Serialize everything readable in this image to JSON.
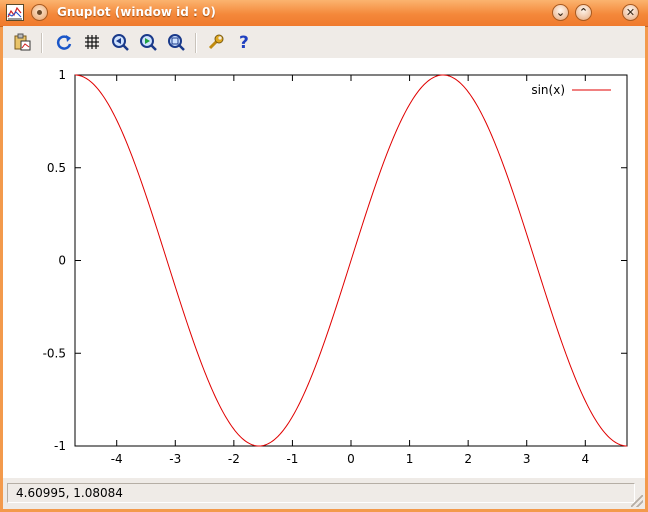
{
  "window": {
    "title": "Gnuplot (window id : 0)"
  },
  "toolbar": {
    "items": [
      {
        "name": "copy-clipboard-icon"
      },
      {
        "name": "replot-icon"
      },
      {
        "name": "grid-icon"
      },
      {
        "name": "zoom-prev-icon"
      },
      {
        "name": "zoom-next-icon"
      },
      {
        "name": "zoom-autoscale-icon"
      },
      {
        "name": "settings-wrench-icon"
      },
      {
        "name": "help-icon"
      }
    ]
  },
  "status": {
    "coordinates": "4.60995,  1.08084"
  },
  "chart_data": {
    "type": "line",
    "title": "",
    "xlabel": "",
    "ylabel": "",
    "xlim": [
      -4.712,
      4.712
    ],
    "ylim": [
      -1,
      1
    ],
    "x_ticks": [
      -4,
      -3,
      -2,
      -1,
      0,
      1,
      2,
      3,
      4
    ],
    "y_ticks": [
      1,
      0.5,
      0,
      -0.5,
      -1
    ],
    "y_tick_labels": [
      "1",
      "0.5",
      "0",
      "-0.5",
      "-1"
    ],
    "grid": false,
    "legend_position": "top-right",
    "series": [
      {
        "name": "sin(x)",
        "color": "#e00000",
        "function": "sin(x)"
      }
    ]
  }
}
